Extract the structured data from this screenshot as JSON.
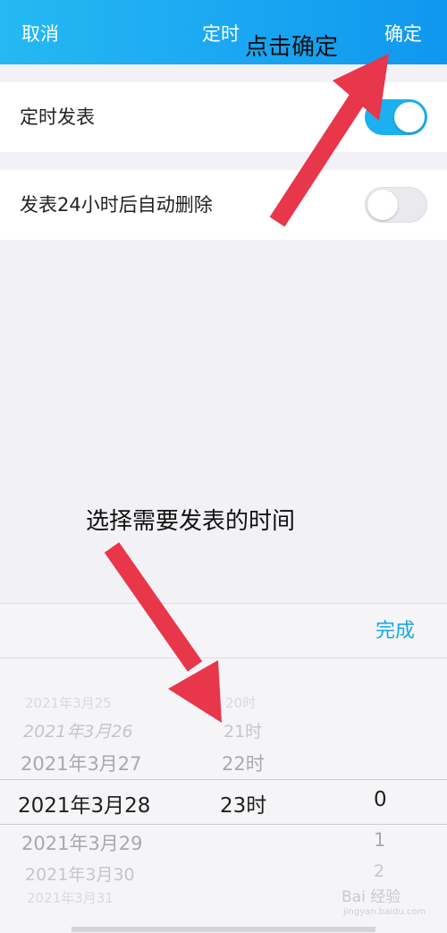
{
  "header": {
    "cancel_label": "取消",
    "title": "定时",
    "confirm_label": "确定"
  },
  "settings": [
    {
      "label": "定时发表",
      "toggle_on": true
    },
    {
      "label": "发表24小时后自动删除",
      "toggle_on": false
    }
  ],
  "picker": {
    "done_label": "完成",
    "dates": [
      {
        "text": "2021年3月25",
        "state": "faint"
      },
      {
        "text": "2021年3月26",
        "state": "far"
      },
      {
        "text": "2021年3月27",
        "state": "near"
      },
      {
        "text": "2021年3月28",
        "state": "selected"
      },
      {
        "text": "2021年3月29",
        "state": "near"
      },
      {
        "text": "2021年3月30",
        "state": "far"
      },
      {
        "text": "2021年3月31",
        "state": "faint"
      }
    ],
    "hours": [
      {
        "text": "20时",
        "state": "faint"
      },
      {
        "text": "21时",
        "state": "far"
      },
      {
        "text": "22时",
        "state": "near"
      },
      {
        "text": "23时",
        "state": "selected"
      }
    ],
    "minutes": [
      {
        "text": "0",
        "state": "selected"
      },
      {
        "text": "1",
        "state": "near"
      },
      {
        "text": "2",
        "state": "far"
      }
    ]
  },
  "annotations": {
    "top_hint": "点击确定",
    "middle_hint": "选择需要发表的时间",
    "arrow_color": "#e8364a"
  },
  "watermark": {
    "text": "Bai 经验",
    "sub": "jingyan.baidu.com"
  },
  "colors": {
    "header_blue": "#1aa6f2",
    "toggle_on": "#1bb0ef",
    "done_blue": "#1aa6e8"
  }
}
